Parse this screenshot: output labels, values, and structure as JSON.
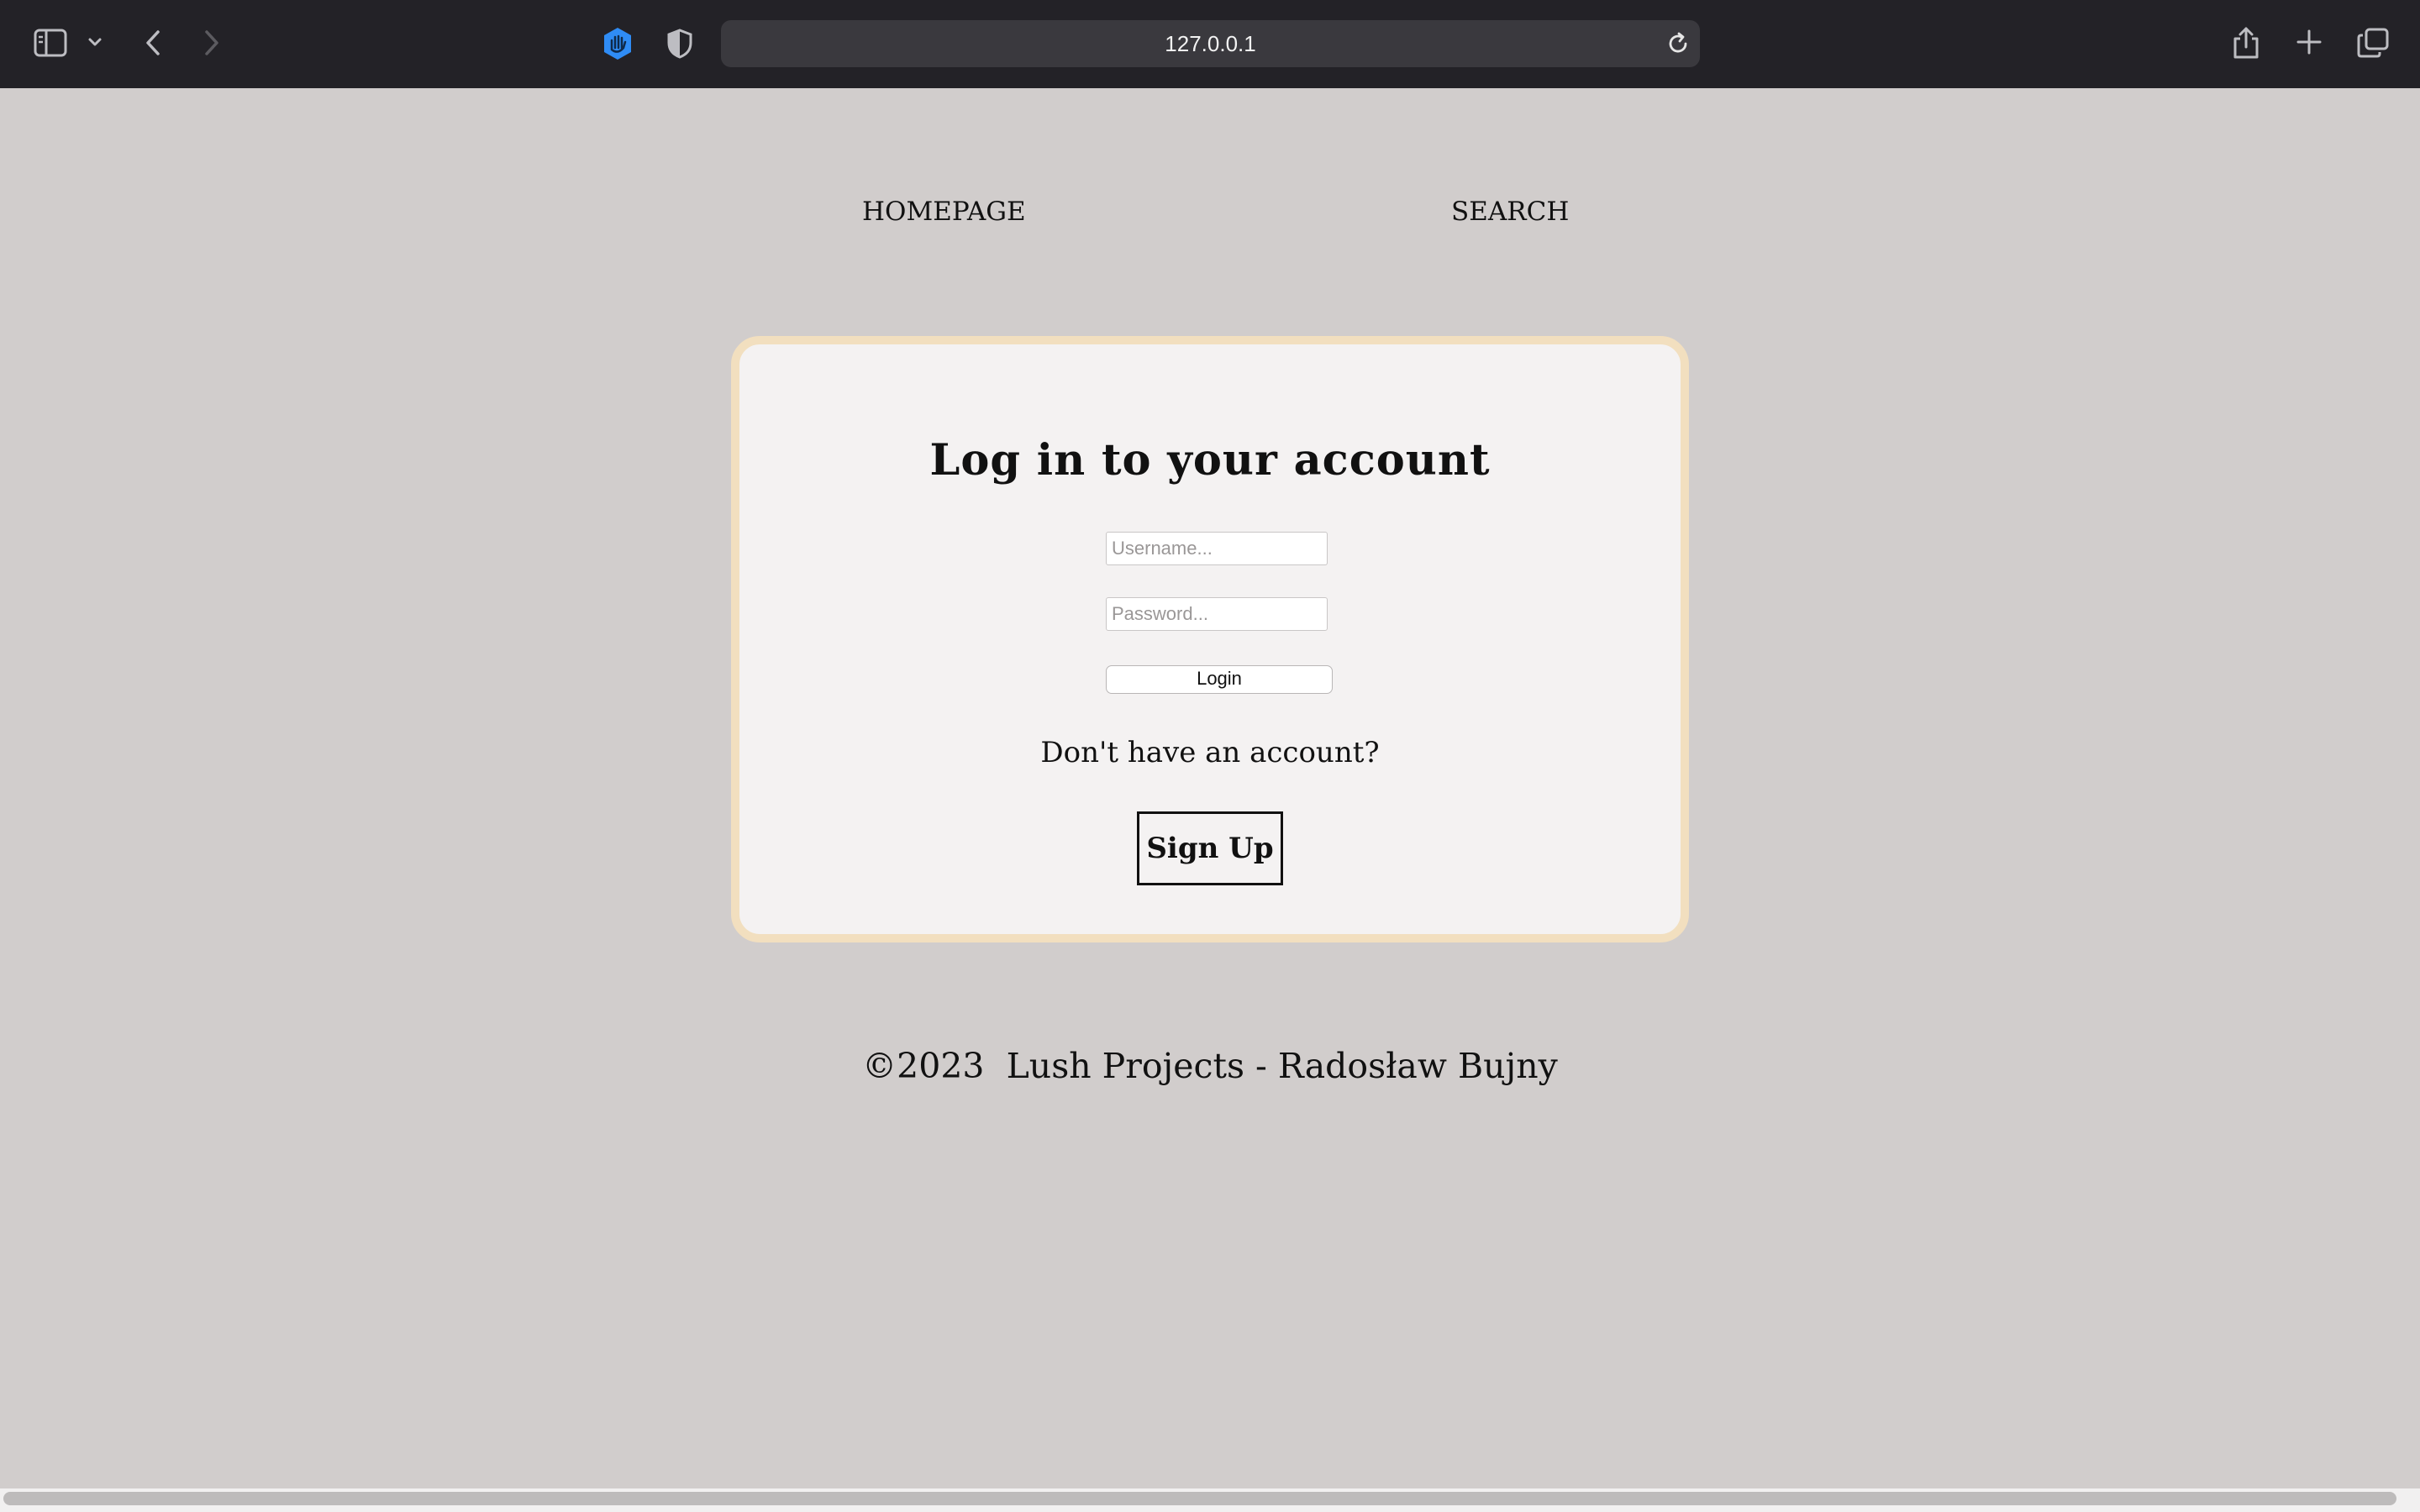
{
  "browser": {
    "url": "127.0.0.1",
    "icons": [
      "sidebar-icon",
      "chevron-down-icon",
      "back-icon",
      "forward-icon",
      "privacy-hand-icon",
      "shield-icon",
      "reload-icon",
      "share-icon",
      "new-tab-icon",
      "tabs-overview-icon"
    ]
  },
  "nav": {
    "home_label": "HOMEPAGE",
    "search_label": "SEARCH"
  },
  "login": {
    "title": "Log in to your account",
    "username_placeholder": "Username...",
    "password_placeholder": "Password...",
    "login_label": "Login",
    "no_account_text": "Don't have an account?",
    "signup_label": "Sign Up"
  },
  "footer": {
    "text": "©2023  Lush Projects - Radosław Bujny"
  },
  "colors": {
    "page_bg": "#d1cdcc",
    "card_bg": "#f4f2f2",
    "card_border": "#f2dfbf",
    "chrome_bg": "#232227",
    "privacy_blue": "#2f8cf5"
  }
}
